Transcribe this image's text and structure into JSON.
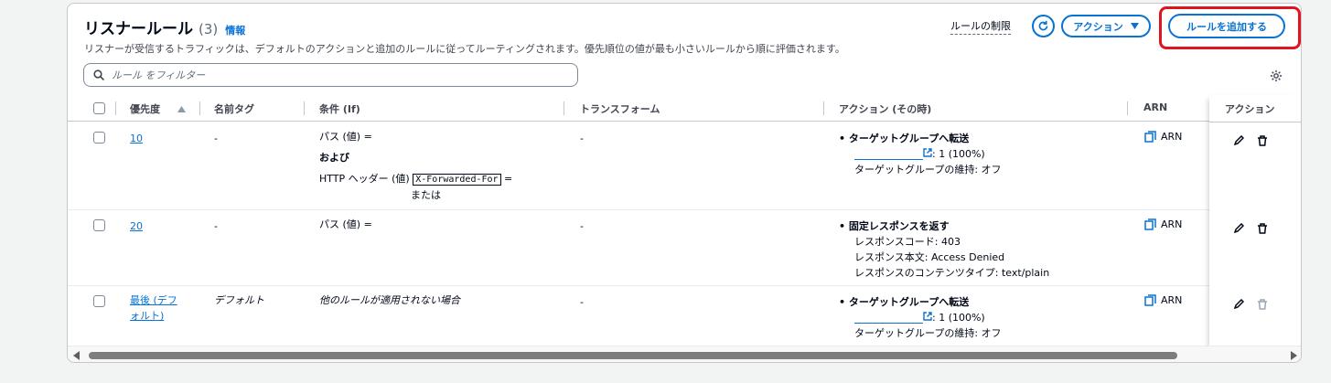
{
  "header": {
    "title": "リスナールール",
    "count": "(3)",
    "info_link": "情報",
    "description": "リスナーが受信するトラフィックは、デフォルトのアクションと追加のルールに従ってルーティングされます。優先順位の値が最も小さいルールから順に評価されます。",
    "rule_limits": "ルールの制限",
    "actions_button": "アクション",
    "add_rule_button": "ルールを追加する"
  },
  "filter": {
    "placeholder": "ルール をフィルター"
  },
  "columns": {
    "priority": "優先度",
    "name_tag": "名前タグ",
    "condition": "条件 (If)",
    "transform": "トランスフォーム",
    "action": "アクション (その時)",
    "arn": "ARN",
    "actions": "アクション"
  },
  "rows": [
    {
      "priority": "10",
      "name_tag": "-",
      "cond_1": "パス (値) =",
      "cond_and": "および",
      "cond_2": "HTTP ヘッダー (値)",
      "cond_header": "X-Forwarded-For",
      "cond_eq": "=",
      "cond_or": "または",
      "transform": "-",
      "action_title": "ターゲットグループへ転送",
      "action_weight": ": 1 (100%)",
      "action_stickiness": "ターゲットグループの維持: オフ",
      "arn": "ARN"
    },
    {
      "priority": "20",
      "name_tag": "-",
      "cond_1": "パス (値) =",
      "transform": "-",
      "action_title": "固定レスポンスを返す",
      "action_code": "レスポンスコード: 403",
      "action_body": "レスポンス本文: Access Denied",
      "action_ctype": "レスポンスのコンテンツタイプ: text/plain",
      "arn": "ARN"
    },
    {
      "priority": "最後 (デフォルト)",
      "priority_line1": "最後 (デフ",
      "priority_line2": "ォルト)",
      "name_tag": "デフォルト",
      "cond_1": "他のルールが適用されない場合",
      "transform": "-",
      "action_title": "ターゲットグループへ転送",
      "action_weight": ": 1 (100%)",
      "action_stickiness": "ターゲットグループの維持: オフ",
      "arn": "ARN"
    }
  ],
  "colors": {
    "accent": "#0972d3",
    "highlight": "#e0141e"
  }
}
